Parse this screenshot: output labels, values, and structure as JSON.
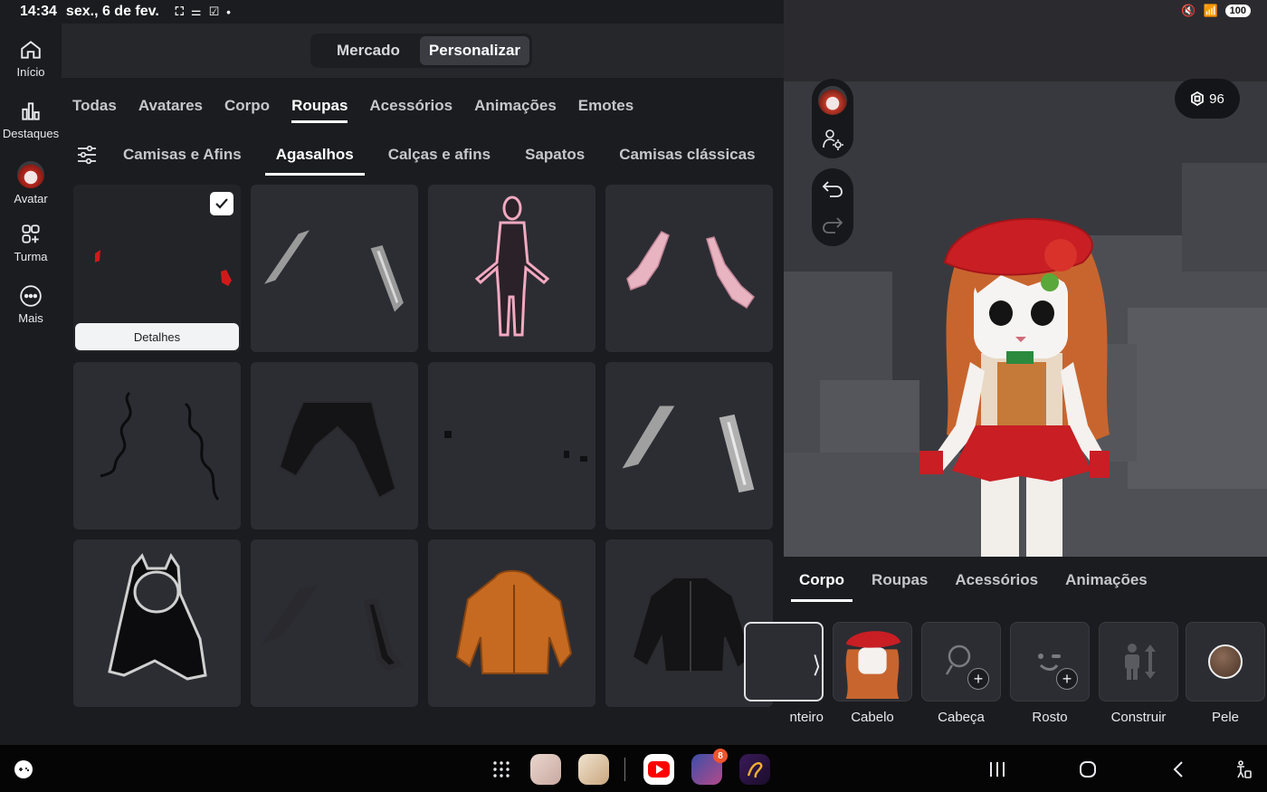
{
  "status_bar": {
    "time": "14:34",
    "date": "sex., 6 de fev.",
    "battery": "100"
  },
  "sidebar": {
    "items": [
      {
        "label": "Início",
        "icon": "home-icon"
      },
      {
        "label": "Destaques",
        "icon": "chart-icon"
      },
      {
        "label": "Avatar",
        "icon": "avatar-icon"
      },
      {
        "label": "Turma",
        "icon": "group-icon"
      },
      {
        "label": "Mais",
        "icon": "more-icon"
      }
    ]
  },
  "top_switch": {
    "options": [
      "Mercado",
      "Personalizar"
    ],
    "selected": "Personalizar"
  },
  "main_tabs": [
    "Todas",
    "Avatares",
    "Corpo",
    "Roupas",
    "Acessórios",
    "Animações",
    "Emotes"
  ],
  "main_tabs_active": "Roupas",
  "sub_tabs": [
    "Camisas e Afins",
    "Agasalhos",
    "Calças e afins",
    "Sapatos",
    "Camisas clássicas"
  ],
  "sub_tabs_active": "Agasalhos",
  "grid": {
    "details_label": "Detalhes",
    "items": [
      {
        "icon": "red-sleeves-icon",
        "selected": true
      },
      {
        "icon": "white-leg-warmers-icon",
        "selected": false
      },
      {
        "icon": "pink-outline-body-icon",
        "selected": false
      },
      {
        "icon": "pink-frilly-sleeves-icon",
        "selected": false
      },
      {
        "icon": "black-ribbon-laces-icon",
        "selected": false
      },
      {
        "icon": "black-wide-pants-icon",
        "selected": false
      },
      {
        "icon": "small-black-pieces-icon",
        "selected": false
      },
      {
        "icon": "white-arm-warmers-icon",
        "selected": false
      },
      {
        "icon": "black-cat-hoodie-cape-icon",
        "selected": false
      },
      {
        "icon": "black-gloves-icon",
        "selected": false
      },
      {
        "icon": "orange-hoodie-icon",
        "selected": false
      },
      {
        "icon": "black-leather-jacket-icon",
        "selected": false
      }
    ]
  },
  "viewport": {
    "robux": "96",
    "tools": [
      "avatar-thumb-icon",
      "avatar-settings-icon",
      "undo-icon",
      "redo-icon"
    ]
  },
  "body_panel": {
    "tabs": [
      "Corpo",
      "Roupas",
      "Acessórios",
      "Animações"
    ],
    "active": "Corpo",
    "parts": [
      {
        "label": "nteiro",
        "icon": "full-body-icon"
      },
      {
        "label": "Cabelo",
        "icon": "hair-icon"
      },
      {
        "label": "Cabeça",
        "icon": "head-icon"
      },
      {
        "label": "Rosto",
        "icon": "face-icon"
      },
      {
        "label": "Construir",
        "icon": "build-icon"
      },
      {
        "label": "Pele",
        "icon": "skin-tone-icon"
      }
    ]
  },
  "colors": {
    "background": "#1b1c1f",
    "card": "#2c2d33",
    "accent": "#ffffff",
    "hair": "#c8652e",
    "outfit_red": "#c81e24"
  },
  "navbar": {
    "apps": [
      "gamepad-icon",
      "apps-grid-icon",
      "photo-app-icon",
      "cake-app-icon",
      "youtube-icon",
      "game-app-icon",
      "stylus-app-icon"
    ],
    "game_badge": "8",
    "buttons": [
      "recents-icon",
      "home-nav-icon",
      "back-icon",
      "accessibility-icon"
    ]
  }
}
